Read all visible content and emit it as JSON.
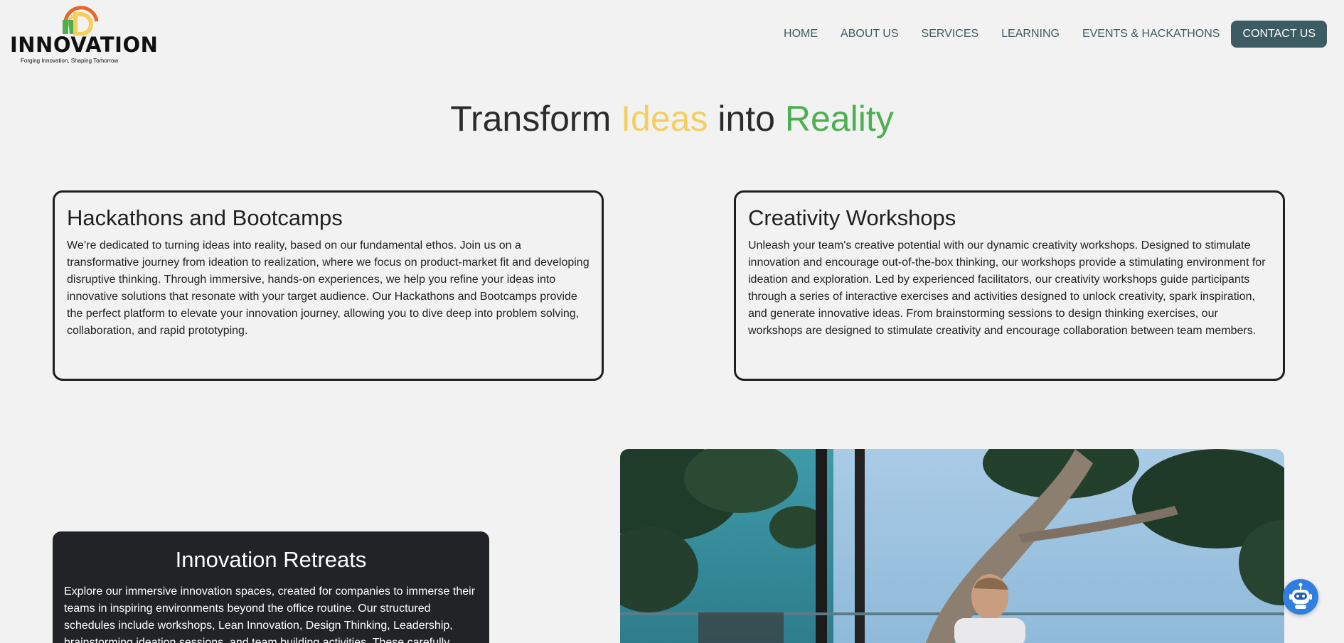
{
  "logo": {
    "word": "INNOVATION",
    "tagline": "Forging Innovation, Shaping Tomorrow",
    "colors": {
      "orange": "#e8662a",
      "yellow": "#f4ce5f",
      "green": "#4caf50"
    }
  },
  "nav": {
    "items": [
      {
        "label": "HOME"
      },
      {
        "label": "ABOUT US"
      },
      {
        "label": "SERVICES"
      },
      {
        "label": "LEARNING"
      },
      {
        "label": "EVENTS & HACKATHONS"
      }
    ],
    "cta": "CONTACT US",
    "accent": "#3d5b62"
  },
  "hero": {
    "word1": "Transform",
    "word2": "Ideas",
    "word3": "into",
    "word4": "Reality"
  },
  "cards": [
    {
      "title": "Hackathons and Bootcamps",
      "text": "We’re dedicated to turning ideas into reality, based on our fundamental ethos. Join us on a transformative journey from ideation to realization, where we focus on product-market fit and developing disruptive thinking. Through immersive, hands-on experiences, we help you refine your ideas into innovative solutions that resonate with your target audience. Our Hackathons and Bootcamps provide the perfect platform to elevate your innovation journey, allowing you to dive deep into problem solving, collaboration, and rapid prototyping."
    },
    {
      "title": "Creativity Workshops",
      "text": "Unleash your team's creative potential with our dynamic creativity workshops. Designed to stimulate innovation and encourage out-of-the-box thinking, our workshops provide a stimulating environment for ideation and exploration. Led by experienced facilitators, our creativity workshops guide participants through a series of interactive exercises and activities designed to unlock creativity, spark inspiration, and generate innovative ideas. From brainstorming sessions to design thinking exercises, our workshops are designed to stimulate creativity and encourage collaboration between team members."
    }
  ],
  "retreat": {
    "title": "Innovation Retreats",
    "text": "Explore our immersive innovation spaces, created for companies to immerse their teams in inspiring environments beyond the office routine. Our structured schedules include workshops, Lean Innovation, Design Thinking, Leadership, brainstorming ideation sessions, and team building activities. These carefully"
  },
  "chatbot": {
    "icon": "robot-icon",
    "color": "#2f7fe0"
  }
}
